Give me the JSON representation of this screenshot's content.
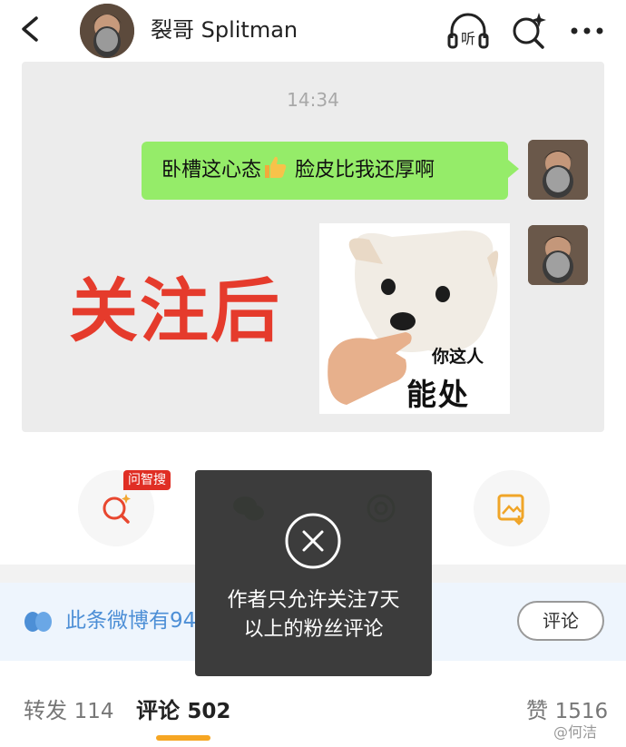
{
  "header": {
    "title": "裂哥 Splitman",
    "back_icon": "chevron-left-icon",
    "listen_label": "听",
    "search_icon": "ai-search-icon",
    "more_icon": "more-dots-icon"
  },
  "post_image": {
    "chat_time": "14:34",
    "message_before": "卧槽这心态",
    "message_emoji": "thumbs-up-icon",
    "message_after": " 脸皮比我还厚啊",
    "overlay_text": "关注后",
    "sticker_small_text": "你这人",
    "sticker_big_text": "能处"
  },
  "actions": {
    "badge": "问智搜",
    "items": [
      "ai-search-icon",
      "wechat-icon",
      "moments-icon",
      "save-image-icon"
    ]
  },
  "notice": {
    "text": "此条微博有94",
    "comment_button": "评论"
  },
  "tabs": {
    "repost_label": "转发",
    "repost_count": "114",
    "comment_label": "评论",
    "comment_count": "502",
    "like_label": "赞",
    "like_count": "1516"
  },
  "watermark": "@何洁",
  "toast": {
    "line1": "作者只允许关注7天",
    "line2": "以上的粉丝评论"
  },
  "colors": {
    "bubble_green": "#95ec69",
    "overlay_red": "#e53b2c",
    "link_blue": "#4d8fd6",
    "tab_underline": "#f6a623",
    "badge_red": "#e02e24"
  }
}
